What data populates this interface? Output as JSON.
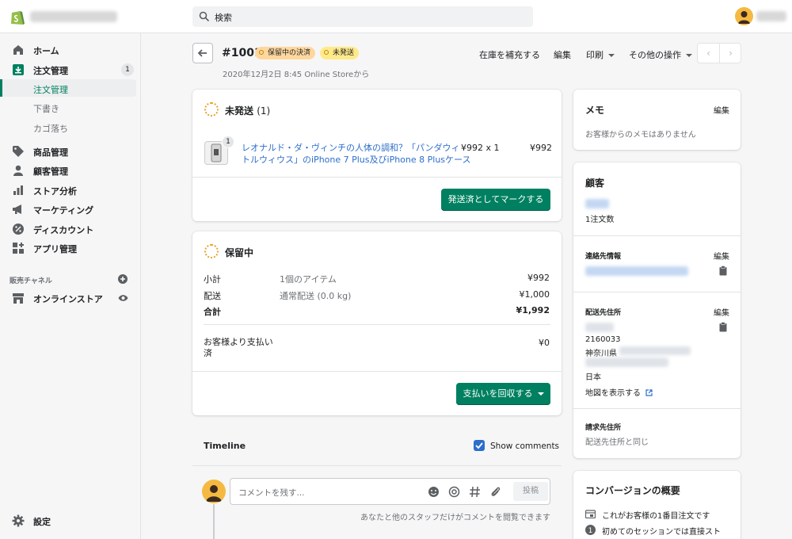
{
  "topbar": {
    "search_placeholder": "検索"
  },
  "sidebar": {
    "home": "ホーム",
    "orders": "注文管理",
    "orders_badge": "1",
    "orders_sub": [
      "注文管理",
      "下書き",
      "カゴ落ち"
    ],
    "products": "商品管理",
    "customers": "顧客管理",
    "analytics": "ストア分析",
    "marketing": "マーケティング",
    "discounts": "ディスカウント",
    "apps": "アプリ管理",
    "sales_channels": "販売チャネル",
    "online_store": "オンラインストア",
    "settings": "設定"
  },
  "header": {
    "order_number": "#1001",
    "tag_payment": "保留中の決済",
    "tag_fulfillment": "未発送",
    "subtitle": "2020年12月2日 8:45 Online Storeから",
    "actions": {
      "restock": "在庫を補充する",
      "edit": "編集",
      "print": "印刷",
      "more": "その他の操作"
    },
    "prev": "‹",
    "next": "›"
  },
  "unfulfilled": {
    "title": "未発送",
    "count": "(1)",
    "item_qty_badge": "1",
    "item_title": "レオナルド・ダ・ヴィンチの人体の調和？「パンダウィトルウィウス」のiPhone 7 Plus及びiPhone 8 Plusケース",
    "item_line1": "レオナルド・ダ・ヴィンチの人体の調和？「パンダウィ",
    "item_line2": "トルウィウス」のiPhone 7 Plus及びiPhone 8 Plusケース",
    "unit_price": "¥992 x 1",
    "total": "¥992",
    "mark_button": "発送済としてマークする"
  },
  "payment": {
    "title": "保留中",
    "rows": [
      {
        "label": "小計",
        "desc": "1個のアイテム",
        "value": "¥992"
      },
      {
        "label": "配送",
        "desc": "通常配送 (0.0 kg)",
        "value": "¥1,000"
      },
      {
        "label": "合計",
        "desc": "",
        "value": "¥1,992"
      }
    ],
    "paid_label_1": "お客様より支払い",
    "paid_label_2": "済",
    "paid_value": "¥0",
    "collect_button": "支払いを回収する"
  },
  "timeline": {
    "title": "Timeline",
    "show_comments": "Show comments",
    "comment_placeholder": "コメントを残す...",
    "post_button": "投稿",
    "note": "あなたと他のスタッフだけがコメントを閲覧できます"
  },
  "memo": {
    "title": "メモ",
    "edit": "編集",
    "empty": "お客様からのメモはありません"
  },
  "customer": {
    "title": "顧客",
    "orders_count": "1注文数",
    "contact_title": "連絡先情報",
    "contact_edit": "編集",
    "shipping_title": "配送先住所",
    "shipping_edit": "編集",
    "postal": "2160033",
    "prefecture": "神奈川県",
    "country": "日本",
    "map_link": "地図を表示する",
    "billing_title": "請求先住所",
    "billing_same": "配送先住所と同じ"
  },
  "conversion": {
    "title": "コンバージョンの概要",
    "line1": "これがお客様の1番目注文です",
    "line2": "初めてのセッションでは直接スト"
  },
  "colors": {
    "primary": "#008060",
    "link": "#2c6ecb",
    "tag_orange": "#ffd79d",
    "tag_yellow": "#ffea8a"
  }
}
